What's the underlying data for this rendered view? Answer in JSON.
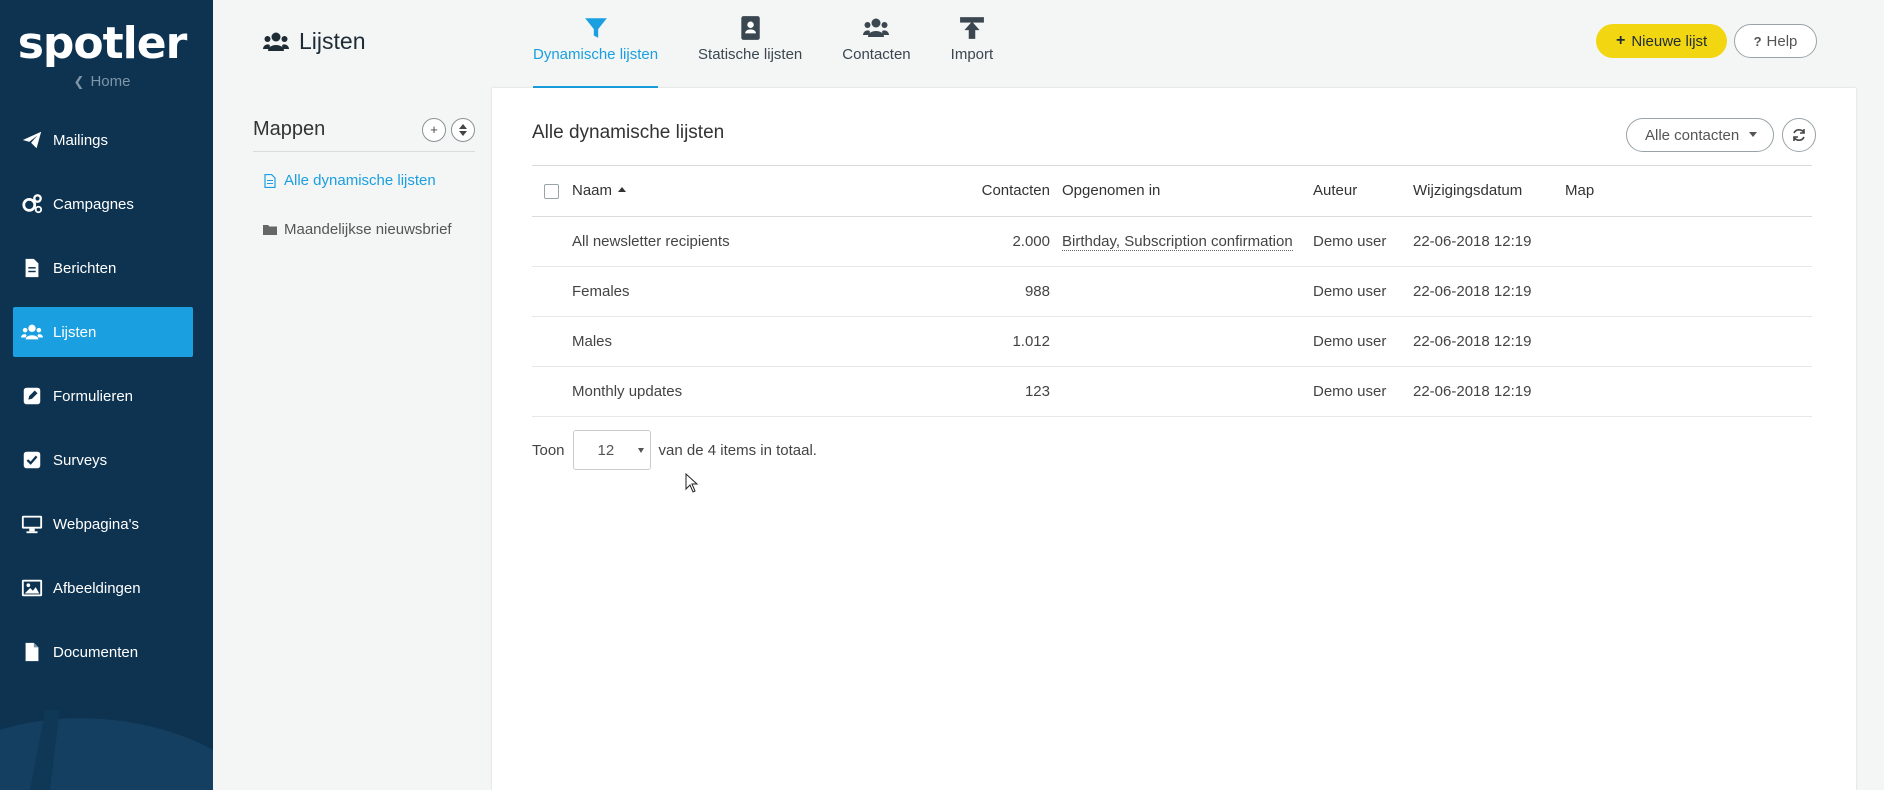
{
  "brand": "spotler",
  "home_link": "Home",
  "nav": [
    {
      "label": "Mailings",
      "icon": "paper-plane-icon"
    },
    {
      "label": "Campagnes",
      "icon": "gears-icon"
    },
    {
      "label": "Berichten",
      "icon": "document-icon"
    },
    {
      "label": "Lijsten",
      "icon": "users-icon",
      "active": true
    },
    {
      "label": "Formulieren",
      "icon": "edit-icon"
    },
    {
      "label": "Surveys",
      "icon": "check-square-icon"
    },
    {
      "label": "Webpagina's",
      "icon": "desktop-icon"
    },
    {
      "label": "Afbeeldingen",
      "icon": "image-icon"
    },
    {
      "label": "Documenten",
      "icon": "file-icon"
    }
  ],
  "page_title": "Lijsten",
  "tabs": [
    {
      "label": "Dynamische lijsten",
      "icon": "filter-icon",
      "active": true
    },
    {
      "label": "Statische lijsten",
      "icon": "address-book-icon"
    },
    {
      "label": "Contacten",
      "icon": "users-icon"
    },
    {
      "label": "Import",
      "icon": "upload-icon"
    }
  ],
  "new_list_button": "Nieuwe lijst",
  "help_button": "Help",
  "folders": {
    "title": "Mappen",
    "items": [
      "Alle dynamische lijsten",
      "Maandelijkse nieuwsbrief"
    ]
  },
  "main": {
    "title": "Alle dynamische lijsten",
    "filter": "Alle contacten",
    "columns": {
      "name": "Naam",
      "contacts": "Contacten",
      "included": "Opgenomen in",
      "author": "Auteur",
      "modified": "Wijzigingsdatum",
      "folder": "Map"
    },
    "rows": [
      {
        "name": "All newsletter recipients",
        "contacts": "2.000",
        "included": "Birthday, Subscription confirmation",
        "author": "Demo user",
        "modified": "22-06-2018 12:19",
        "folder": ""
      },
      {
        "name": "Females",
        "contacts": "988",
        "included": "",
        "author": "Demo user",
        "modified": "22-06-2018 12:19",
        "folder": ""
      },
      {
        "name": "Males",
        "contacts": "1.012",
        "included": "",
        "author": "Demo user",
        "modified": "22-06-2018 12:19",
        "folder": ""
      },
      {
        "name": "Monthly updates",
        "contacts": "123",
        "included": "",
        "author": "Demo user",
        "modified": "22-06-2018 12:19",
        "folder": ""
      }
    ],
    "pager": {
      "show_label": "Toon",
      "page_size": "12",
      "summary": "van de 4 items in totaal."
    }
  },
  "colors": {
    "sidebar": "#0d3350",
    "accent": "#1aa0e0",
    "primary_button": "#f3d612"
  }
}
